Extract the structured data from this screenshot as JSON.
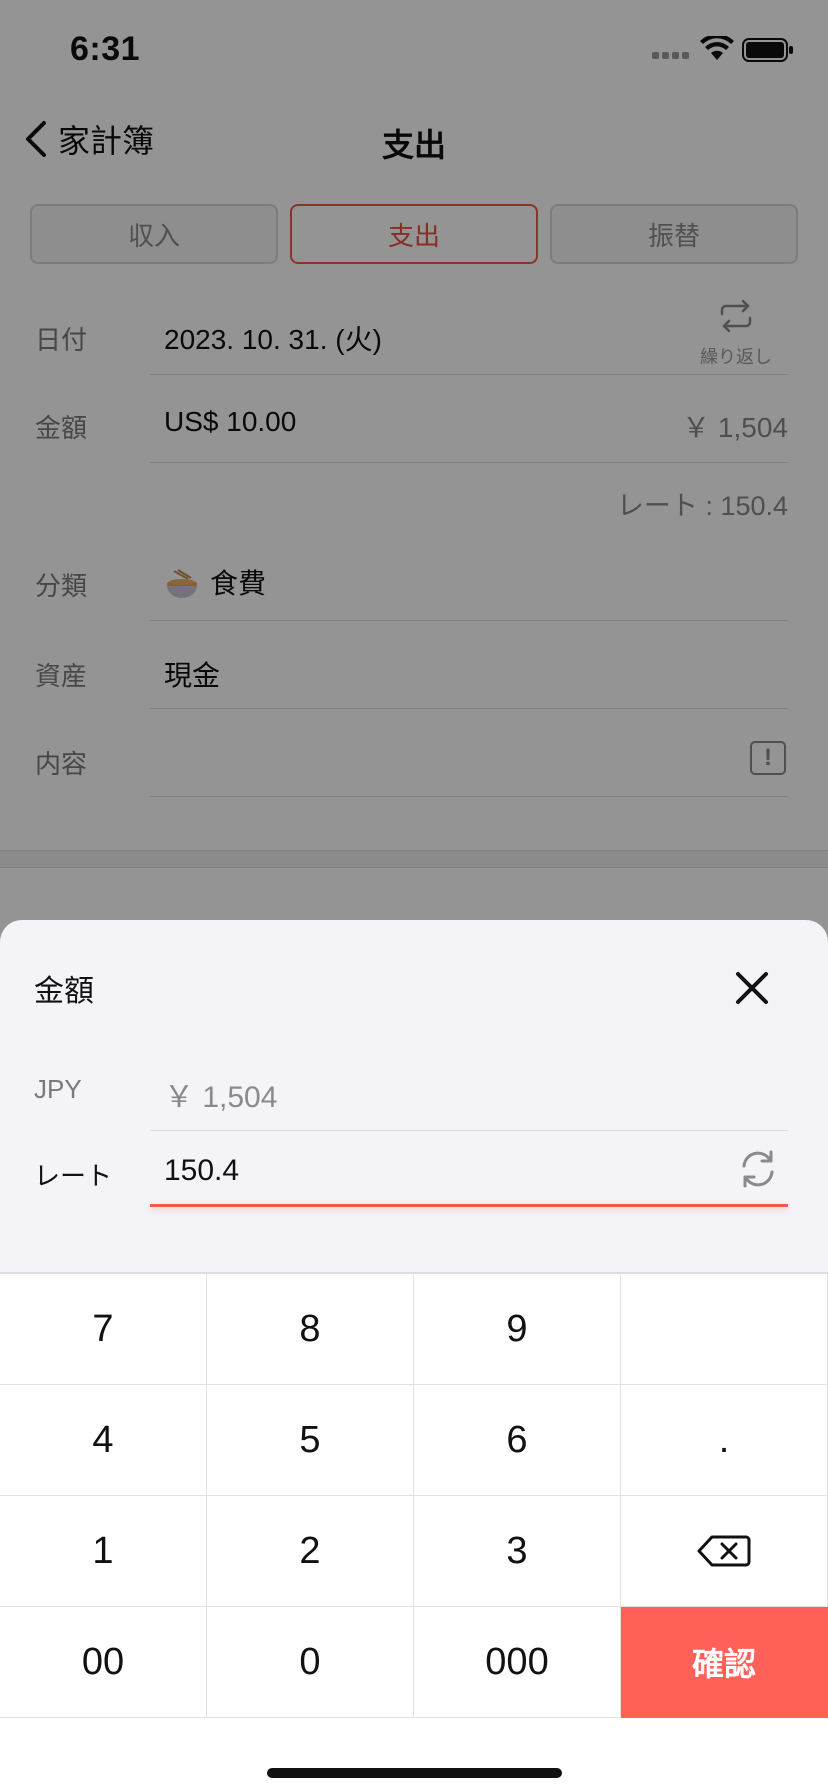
{
  "status_bar": {
    "time": "6:31"
  },
  "nav": {
    "back_label": "家計簿",
    "title": "支出"
  },
  "segments": [
    {
      "label": "収入",
      "active": false
    },
    {
      "label": "支出",
      "active": true
    },
    {
      "label": "振替",
      "active": false
    }
  ],
  "form": {
    "date": {
      "label": "日付",
      "value": "2023. 10. 31. (火)",
      "repeat_label": "繰り返し"
    },
    "amount": {
      "label": "金額",
      "value": "US$ 10.00",
      "converted": "￥ 1,504",
      "rate_text": "レート : 150.4"
    },
    "category": {
      "label": "分類",
      "value": "食費",
      "icon": "ramen-bowl-icon"
    },
    "asset": {
      "label": "資産",
      "value": "現金"
    },
    "content": {
      "label": "内容",
      "value": ""
    }
  },
  "sheet": {
    "title": "金額",
    "jpy_label": "JPY",
    "jpy_value": "￥ 1,504",
    "rate_label": "レート",
    "rate_value": "150.4"
  },
  "keypad": {
    "keys": [
      "7",
      "8",
      "9",
      "",
      "4",
      "5",
      "6",
      ".",
      "1",
      "2",
      "3",
      "",
      "00",
      "0",
      "000",
      "確認"
    ]
  },
  "colors": {
    "accent": "#f05b49",
    "confirm": "#ff6058",
    "sheet_bg": "#f4f3f8"
  }
}
